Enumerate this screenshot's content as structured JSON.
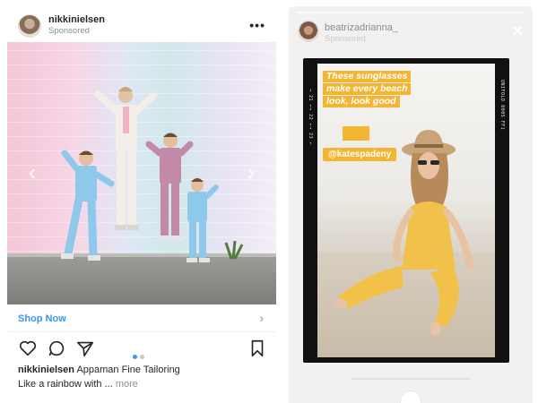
{
  "feed_post": {
    "username": "nikkinielsen",
    "sponsored_label": "Sponsored",
    "more_label": "•••",
    "cta_label": "Shop Now",
    "cta_chevron": "›",
    "nav_prev": "‹",
    "nav_next": "›",
    "carousel": {
      "count": 2,
      "active_index": 0
    },
    "caption": {
      "username": "nikkinielsen",
      "text": "Appaman Fine Tailoring",
      "line2": "Like a rainbow with ...",
      "more_label": "more"
    },
    "icons": [
      "heart-icon",
      "comment-icon",
      "share-icon",
      "bookmark-icon"
    ]
  },
  "story": {
    "username": "beatrizadrianna_",
    "sponsored_label": "Sponsored",
    "close_label": "✕",
    "sticker_lines": [
      "These sunglasses",
      "make every beach",
      "look, look good"
    ],
    "mention": "@katespadeny",
    "film_side_text_left": "→ 21 ←→ 22 ←→ 23 ←",
    "film_side_text_right": "UNIFOLD 800S FF1"
  },
  "colors": {
    "accent_blue": "#3897f0",
    "sticker_yellow": "#f4b533",
    "outfit_yellow": "#f2c14a",
    "suit_blue": "#8ec9ec",
    "suit_pink": "#c28aa7",
    "suit_white": "#f3efe8"
  }
}
